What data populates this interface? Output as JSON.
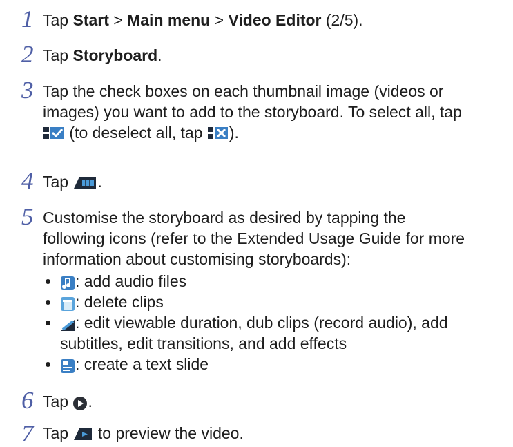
{
  "steps": [
    {
      "num": "1",
      "a": "Tap ",
      "b1": "Start",
      "c": " > ",
      "b2": "Main menu",
      "d": " > ",
      "b3": "Video Editor",
      "e": " (2/5)."
    },
    {
      "num": "2",
      "a": "Tap ",
      "b1": "Storyboard",
      "e": "."
    },
    {
      "num": "3",
      "line1": "Tap the check boxes on each thumbnail image (videos or",
      "line2": "images) you want to add to the storyboard. To select all, tap",
      "line3a": " (to deselect all, tap ",
      "line3b": ")."
    },
    {
      "num": "4",
      "a": "Tap ",
      "e": "."
    },
    {
      "num": "5",
      "line1": "Customise the storyboard as desired by tapping the",
      "line2": "following icons (refer to the Extended Usage Guide for more",
      "line3": "information about customising storyboards):",
      "items": [
        {
          "icon": "audio-icon",
          "text": ": add audio files"
        },
        {
          "icon": "delete-clips-icon",
          "text": ": delete clips"
        },
        {
          "icon": "edit-clip-icon",
          "text": ": edit viewable duration, dub clips (record audio), add",
          "text2": "subtitles, edit transitions, and add effects"
        },
        {
          "icon": "text-slide-icon",
          "text": ": create a text slide"
        }
      ]
    },
    {
      "num": "6",
      "a": "Tap ",
      "e": "."
    },
    {
      "num": "7",
      "a": "Tap ",
      "e": " to preview the video."
    }
  ],
  "colors": {
    "step_number": "#4f5fa6",
    "text": "#1e1e1e",
    "icon_dark": "#1f2a3a",
    "icon_blue": "#3a7fc4"
  }
}
